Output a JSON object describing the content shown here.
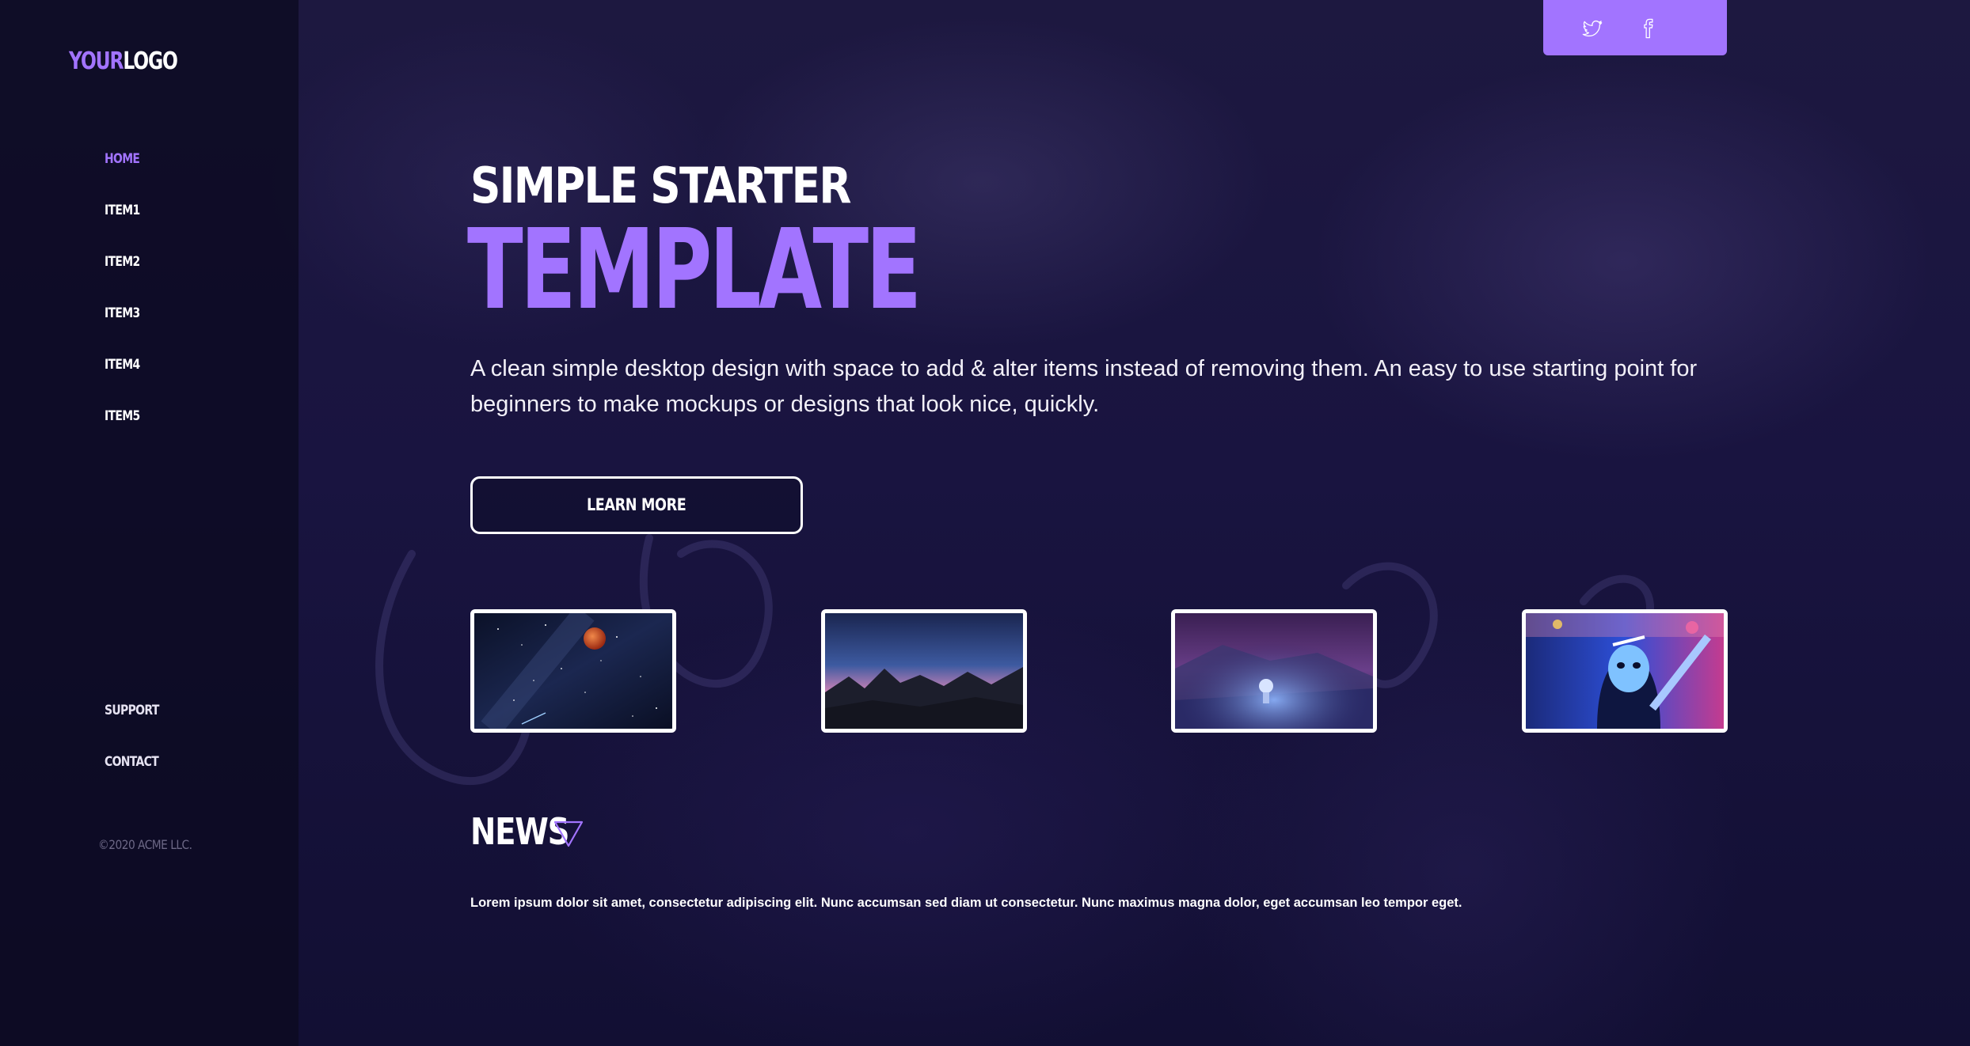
{
  "logo": {
    "prefix": "YOUR",
    "suffix": "LOGO"
  },
  "nav": {
    "items": [
      {
        "label": "HOME",
        "active": true
      },
      {
        "label": "ITEM1",
        "active": false
      },
      {
        "label": "ITEM2",
        "active": false
      },
      {
        "label": "ITEM3",
        "active": false
      },
      {
        "label": "ITEM4",
        "active": false
      },
      {
        "label": "ITEM5",
        "active": false
      }
    ],
    "secondary": [
      {
        "label": "SUPPORT"
      },
      {
        "label": "CONTACT"
      }
    ],
    "copyright": "©2020 ACME LLC."
  },
  "social": {
    "icons": [
      "twitter-icon",
      "facebook-icon"
    ]
  },
  "hero": {
    "kicker": "SIMPLE STARTER",
    "title": "TEMPLATE",
    "description": "A clean simple desktop design with space to add & alter items instead of removing them. An easy to use starting point for beginners to make mockups or designs that look nice, quickly.",
    "button_label": "LEARN MORE"
  },
  "gallery": {
    "images": [
      "night-sky-blood-moon",
      "mountain-sunset-sky",
      "astronaut-snowfield",
      "neon-masked-figure"
    ]
  },
  "news": {
    "title": "NEWS",
    "text": "Lorem ipsum dolor sit amet, consectetur adipiscing elit. Nunc accumsan sed diam ut consectetur. Nunc maximus magna dolor, eget accumsan leo tempor eget."
  },
  "colors": {
    "accent": "#a274ff",
    "background": "#171235",
    "sidebar": "#0c0a20",
    "text": "#ffffff"
  }
}
